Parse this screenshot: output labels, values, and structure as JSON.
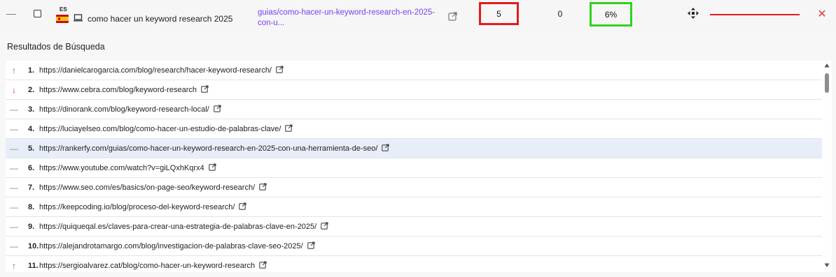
{
  "keyword_row": {
    "collapse_symbol": "—",
    "language": "ES",
    "flag": "spain-flag",
    "device_icon": "laptop-icon",
    "keyword": "como hacer un keyword research 2025",
    "ranking_url": "guias/como-hacer-un-keyword-research-en-2025-con-u...",
    "position": "5",
    "change": "0",
    "visibility": "6%",
    "trend_color": "#e41b1b",
    "position_border_color": "#e41b1b",
    "visibility_border_color": "#2fd31c",
    "remove_symbol": "✕"
  },
  "results_title": "Resultados de Búsqueda",
  "results": [
    {
      "trend": "up",
      "symbol": "↑",
      "rank": "1.",
      "url": "https://danielcarogarcia.com/blog/research/hacer-keyword-research/"
    },
    {
      "trend": "down",
      "symbol": "↓",
      "rank": "2.",
      "url": "https://www.cebra.com/blog/keyword-research"
    },
    {
      "trend": "flat",
      "symbol": "—",
      "rank": "3.",
      "url": "https://dinorank.com/blog/keyword-research-local/"
    },
    {
      "trend": "flat",
      "symbol": "—",
      "rank": "4.",
      "url": "https://luciayelseo.com/blog/como-hacer-un-estudio-de-palabras-clave/"
    },
    {
      "trend": "flat",
      "symbol": "—",
      "rank": "5.",
      "url": "https://rankerfy.com/guias/como-hacer-un-keyword-research-en-2025-con-una-herramienta-de-seo/",
      "highlight": true
    },
    {
      "trend": "flat",
      "symbol": "—",
      "rank": "6.",
      "url": "https://www.youtube.com/watch?v=giLQxhKqrx4"
    },
    {
      "trend": "flat",
      "symbol": "—",
      "rank": "7.",
      "url": "https://www.seo.com/es/basics/on-page-seo/keyword-research/"
    },
    {
      "trend": "flat",
      "symbol": "—",
      "rank": "8.",
      "url": "https://keepcoding.io/blog/proceso-del-keyword-research/"
    },
    {
      "trend": "flat",
      "symbol": "—",
      "rank": "9.",
      "url": "https://quiqueqal.es/claves-para-crear-una-estrategia-de-palabras-clave-en-2025/"
    },
    {
      "trend": "flat",
      "symbol": "—",
      "rank": "10.",
      "url": "https://alejandrotamargo.com/blog/investigacion-de-palabras-clave-seo-2025/"
    },
    {
      "trend": "up",
      "symbol": "↑",
      "rank": "11.",
      "url": "https://sergioalvarez.cat/blog/como-hacer-un-keyword-research"
    }
  ]
}
